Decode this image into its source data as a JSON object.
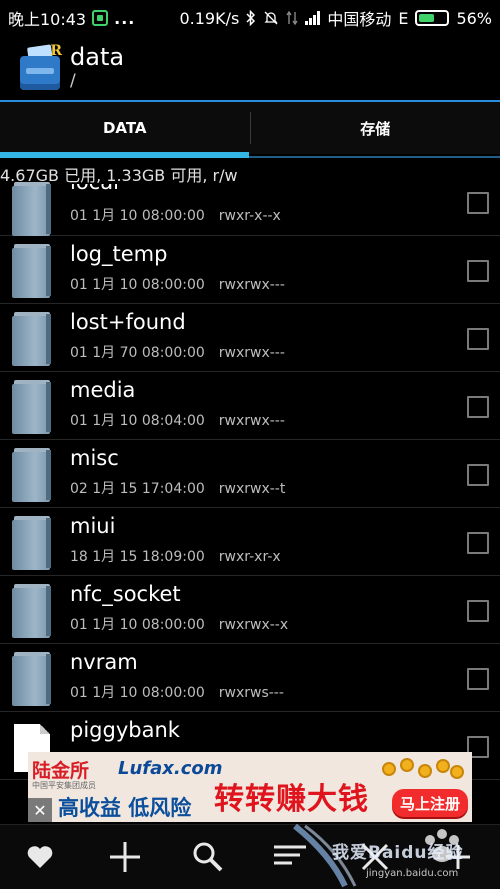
{
  "status_bar": {
    "time": "晚上10:43",
    "dots": "...",
    "speed": "0.19K/s",
    "carrier": "中国移动",
    "network": "E",
    "battery": "56%",
    "battery_level": 0.56
  },
  "header": {
    "title": "data",
    "path": "/",
    "app_icon": "root-explorer-icon"
  },
  "tabs": [
    {
      "label": "DATA",
      "active": true
    },
    {
      "label": "存储",
      "active": false
    }
  ],
  "storage_info": "4.67GB 已用, 1.33GB 可用, r/w",
  "files": [
    {
      "name": "local",
      "date": "01 1月 10 08:00:00",
      "perm": "rwxr-x--x",
      "type": "folder"
    },
    {
      "name": "log_temp",
      "date": "01 1月 10 08:00:00",
      "perm": "rwxrwx---",
      "type": "folder"
    },
    {
      "name": "lost+found",
      "date": "01 1月 70 08:00:00",
      "perm": "rwxrwx---",
      "type": "folder"
    },
    {
      "name": "media",
      "date": "01 1月 10 08:04:00",
      "perm": "rwxrwx---",
      "type": "folder"
    },
    {
      "name": "misc",
      "date": "02 1月 15 17:04:00",
      "perm": "rwxrwx--t",
      "type": "folder"
    },
    {
      "name": "miui",
      "date": "18 1月 15 18:09:00",
      "perm": "rwxr-xr-x",
      "type": "folder"
    },
    {
      "name": "nfc_socket",
      "date": "01 1月 10 08:00:00",
      "perm": "rwxrwx--x",
      "type": "folder"
    },
    {
      "name": "nvram",
      "date": "01 1月 10 08:00:00",
      "perm": "rwxrws---",
      "type": "folder"
    },
    {
      "name": "piggybank",
      "date": "",
      "perm": "",
      "type": "file"
    }
  ],
  "ad": {
    "brand_cn": "陆金所",
    "brand_en": "Lufax.com",
    "org": "中国平安集团成员",
    "slogan": "高收益 低风险",
    "headline": "转转赚大钱",
    "cta": "马上注册",
    "close": "✕"
  },
  "toolbar": {
    "icons": [
      "heart-icon",
      "add-icon",
      "search-icon",
      "sort-icon",
      "close-icon",
      "more-icon"
    ]
  },
  "watermark": {
    "text": "我爱Baidu经验",
    "url": "jingyan.baidu.com"
  }
}
